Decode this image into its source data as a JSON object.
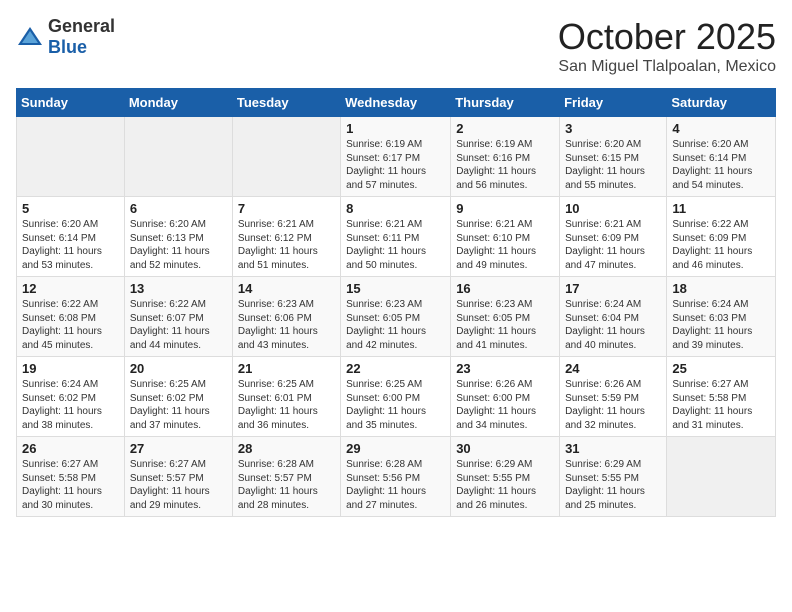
{
  "logo": {
    "text_general": "General",
    "text_blue": "Blue"
  },
  "header": {
    "month": "October 2025",
    "location": "San Miguel Tlalpoalan, Mexico"
  },
  "weekdays": [
    "Sunday",
    "Monday",
    "Tuesday",
    "Wednesday",
    "Thursday",
    "Friday",
    "Saturday"
  ],
  "weeks": [
    [
      {
        "day": "",
        "info": ""
      },
      {
        "day": "",
        "info": ""
      },
      {
        "day": "",
        "info": ""
      },
      {
        "day": "1",
        "info": "Sunrise: 6:19 AM\nSunset: 6:17 PM\nDaylight: 11 hours\nand 57 minutes."
      },
      {
        "day": "2",
        "info": "Sunrise: 6:19 AM\nSunset: 6:16 PM\nDaylight: 11 hours\nand 56 minutes."
      },
      {
        "day": "3",
        "info": "Sunrise: 6:20 AM\nSunset: 6:15 PM\nDaylight: 11 hours\nand 55 minutes."
      },
      {
        "day": "4",
        "info": "Sunrise: 6:20 AM\nSunset: 6:14 PM\nDaylight: 11 hours\nand 54 minutes."
      }
    ],
    [
      {
        "day": "5",
        "info": "Sunrise: 6:20 AM\nSunset: 6:14 PM\nDaylight: 11 hours\nand 53 minutes."
      },
      {
        "day": "6",
        "info": "Sunrise: 6:20 AM\nSunset: 6:13 PM\nDaylight: 11 hours\nand 52 minutes."
      },
      {
        "day": "7",
        "info": "Sunrise: 6:21 AM\nSunset: 6:12 PM\nDaylight: 11 hours\nand 51 minutes."
      },
      {
        "day": "8",
        "info": "Sunrise: 6:21 AM\nSunset: 6:11 PM\nDaylight: 11 hours\nand 50 minutes."
      },
      {
        "day": "9",
        "info": "Sunrise: 6:21 AM\nSunset: 6:10 PM\nDaylight: 11 hours\nand 49 minutes."
      },
      {
        "day": "10",
        "info": "Sunrise: 6:21 AM\nSunset: 6:09 PM\nDaylight: 11 hours\nand 47 minutes."
      },
      {
        "day": "11",
        "info": "Sunrise: 6:22 AM\nSunset: 6:09 PM\nDaylight: 11 hours\nand 46 minutes."
      }
    ],
    [
      {
        "day": "12",
        "info": "Sunrise: 6:22 AM\nSunset: 6:08 PM\nDaylight: 11 hours\nand 45 minutes."
      },
      {
        "day": "13",
        "info": "Sunrise: 6:22 AM\nSunset: 6:07 PM\nDaylight: 11 hours\nand 44 minutes."
      },
      {
        "day": "14",
        "info": "Sunrise: 6:23 AM\nSunset: 6:06 PM\nDaylight: 11 hours\nand 43 minutes."
      },
      {
        "day": "15",
        "info": "Sunrise: 6:23 AM\nSunset: 6:05 PM\nDaylight: 11 hours\nand 42 minutes."
      },
      {
        "day": "16",
        "info": "Sunrise: 6:23 AM\nSunset: 6:05 PM\nDaylight: 11 hours\nand 41 minutes."
      },
      {
        "day": "17",
        "info": "Sunrise: 6:24 AM\nSunset: 6:04 PM\nDaylight: 11 hours\nand 40 minutes."
      },
      {
        "day": "18",
        "info": "Sunrise: 6:24 AM\nSunset: 6:03 PM\nDaylight: 11 hours\nand 39 minutes."
      }
    ],
    [
      {
        "day": "19",
        "info": "Sunrise: 6:24 AM\nSunset: 6:02 PM\nDaylight: 11 hours\nand 38 minutes."
      },
      {
        "day": "20",
        "info": "Sunrise: 6:25 AM\nSunset: 6:02 PM\nDaylight: 11 hours\nand 37 minutes."
      },
      {
        "day": "21",
        "info": "Sunrise: 6:25 AM\nSunset: 6:01 PM\nDaylight: 11 hours\nand 36 minutes."
      },
      {
        "day": "22",
        "info": "Sunrise: 6:25 AM\nSunset: 6:00 PM\nDaylight: 11 hours\nand 35 minutes."
      },
      {
        "day": "23",
        "info": "Sunrise: 6:26 AM\nSunset: 6:00 PM\nDaylight: 11 hours\nand 34 minutes."
      },
      {
        "day": "24",
        "info": "Sunrise: 6:26 AM\nSunset: 5:59 PM\nDaylight: 11 hours\nand 32 minutes."
      },
      {
        "day": "25",
        "info": "Sunrise: 6:27 AM\nSunset: 5:58 PM\nDaylight: 11 hours\nand 31 minutes."
      }
    ],
    [
      {
        "day": "26",
        "info": "Sunrise: 6:27 AM\nSunset: 5:58 PM\nDaylight: 11 hours\nand 30 minutes."
      },
      {
        "day": "27",
        "info": "Sunrise: 6:27 AM\nSunset: 5:57 PM\nDaylight: 11 hours\nand 29 minutes."
      },
      {
        "day": "28",
        "info": "Sunrise: 6:28 AM\nSunset: 5:57 PM\nDaylight: 11 hours\nand 28 minutes."
      },
      {
        "day": "29",
        "info": "Sunrise: 6:28 AM\nSunset: 5:56 PM\nDaylight: 11 hours\nand 27 minutes."
      },
      {
        "day": "30",
        "info": "Sunrise: 6:29 AM\nSunset: 5:55 PM\nDaylight: 11 hours\nand 26 minutes."
      },
      {
        "day": "31",
        "info": "Sunrise: 6:29 AM\nSunset: 5:55 PM\nDaylight: 11 hours\nand 25 minutes."
      },
      {
        "day": "",
        "info": ""
      }
    ]
  ]
}
